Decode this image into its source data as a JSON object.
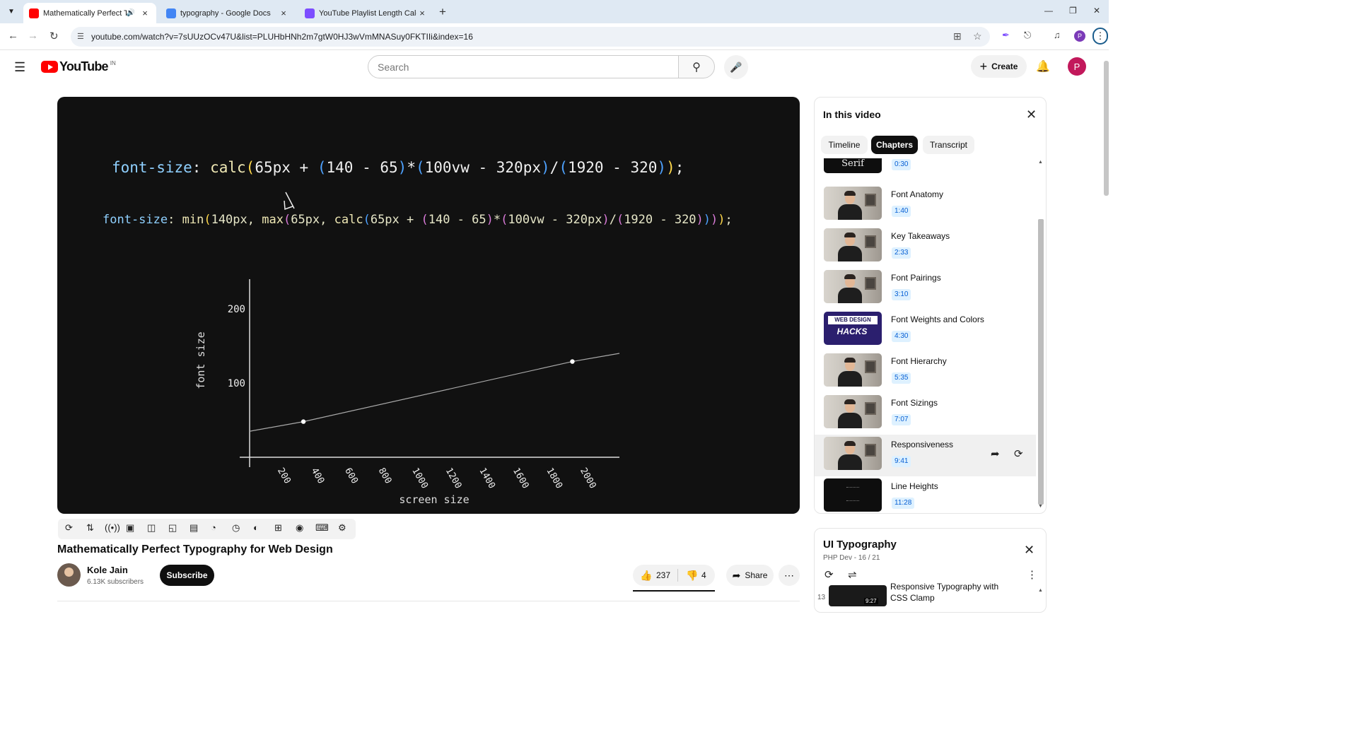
{
  "browser": {
    "tabs": [
      {
        "title": "Mathematically Perfect Typo",
        "active": true
      },
      {
        "title": "typography - Google Docs",
        "active": false
      },
      {
        "title": "YouTube Playlist Length Calcula",
        "active": false
      }
    ],
    "url": "youtube.com/watch?v=7sUUzOCv47U&list=PLUHbHNh2m7gtW0HJ3wVmMNASuy0FKTIIi&index=16"
  },
  "header": {
    "logo_text": "YouTube",
    "country_code": "IN",
    "search_placeholder": "Search",
    "create_label": "Create",
    "avatar_letter": "P"
  },
  "video": {
    "code_line1": [
      {
        "t": "font-size",
        "c": "kw"
      },
      {
        "t": ": ",
        "c": "txt"
      },
      {
        "t": "calc",
        "c": "fn"
      },
      {
        "t": "(",
        "c": "p1"
      },
      {
        "t": "65px + ",
        "c": "txt"
      },
      {
        "t": "(",
        "c": "p3"
      },
      {
        "t": "140 - 65",
        "c": "txt"
      },
      {
        "t": ")",
        "c": "p3"
      },
      {
        "t": "*",
        "c": "txt"
      },
      {
        "t": "(",
        "c": "p3"
      },
      {
        "t": "100vw - 320px",
        "c": "txt"
      },
      {
        "t": ")",
        "c": "p3"
      },
      {
        "t": "/",
        "c": "txt"
      },
      {
        "t": "(",
        "c": "p3"
      },
      {
        "t": "1920 - 320",
        "c": "txt"
      },
      {
        "t": ")",
        "c": "p3"
      },
      {
        "t": ")",
        "c": "p1"
      },
      {
        "t": ";",
        "c": "txt"
      }
    ],
    "code_line2": [
      {
        "t": "font-size",
        "c": "kw"
      },
      {
        "t": ": ",
        "c": "txt"
      },
      {
        "t": "min",
        "c": "fn"
      },
      {
        "t": "(",
        "c": "p1"
      },
      {
        "t": "140px, ",
        "c": "txt"
      },
      {
        "t": "max",
        "c": "fn"
      },
      {
        "t": "(",
        "c": "p2"
      },
      {
        "t": "65px, ",
        "c": "txt"
      },
      {
        "t": "calc",
        "c": "fn"
      },
      {
        "t": "(",
        "c": "p3"
      },
      {
        "t": "65px + ",
        "c": "txt"
      },
      {
        "t": "(",
        "c": "p2"
      },
      {
        "t": "140 - 65",
        "c": "txt"
      },
      {
        "t": ")",
        "c": "p2"
      },
      {
        "t": "*",
        "c": "txt"
      },
      {
        "t": "(",
        "c": "p2"
      },
      {
        "t": "100vw - 320px",
        "c": "txt"
      },
      {
        "t": ")",
        "c": "p2"
      },
      {
        "t": "/",
        "c": "txt"
      },
      {
        "t": "(",
        "c": "p2"
      },
      {
        "t": "1920 - 320",
        "c": "txt"
      },
      {
        "t": ")",
        "c": "p2"
      },
      {
        "t": ")",
        "c": "p3"
      },
      {
        "t": ")",
        "c": "p2"
      },
      {
        "t": ")",
        "c": "p1"
      },
      {
        "t": ";",
        "c": "txt"
      }
    ],
    "title": "Mathematically Perfect Typography for Web Design",
    "channel": "Kole Jain",
    "subscribers": "6.13K subscribers",
    "subscribe_label": "Subscribe",
    "likes": "237",
    "dislikes": "4",
    "share_label": "Share"
  },
  "chart_data": {
    "type": "line",
    "xlabel": "screen size",
    "ylabel": "font size",
    "x_ticks": [
      200,
      400,
      600,
      800,
      1000,
      1200,
      1400,
      1600,
      1800,
      2000
    ],
    "y_ticks": [
      100,
      200
    ],
    "xlim": [
      0,
      2200
    ],
    "ylim": [
      0,
      240
    ],
    "series": [
      {
        "x": [
          0,
          320,
          1920,
          2200
        ],
        "y": [
          35,
          48,
          129,
          140
        ]
      }
    ],
    "points": [
      {
        "x": 320,
        "y": 48
      },
      {
        "x": 1920,
        "y": 129
      }
    ]
  },
  "chapters_panel": {
    "title": "In this video",
    "tabs": [
      "Timeline",
      "Chapters",
      "Transcript"
    ],
    "selected_tab": "Chapters",
    "partial_top": {
      "thumb_text": "Serif",
      "time": "0:30"
    },
    "items": [
      {
        "name": "Font Anatomy",
        "time": "1:40",
        "thumb": "person"
      },
      {
        "name": "Key Takeaways",
        "time": "2:33",
        "thumb": "person"
      },
      {
        "name": "Font Pairings",
        "time": "3:10",
        "thumb": "person"
      },
      {
        "name": "Font Weights and Colors",
        "time": "4:30",
        "thumb": "webdesign"
      },
      {
        "name": "Font Hierarchy",
        "time": "5:35",
        "thumb": "person"
      },
      {
        "name": "Font Sizings",
        "time": "7:07",
        "thumb": "person"
      },
      {
        "name": "Responsiveness",
        "time": "9:41",
        "thumb": "person",
        "highlighted": true
      },
      {
        "name": "Line Heights",
        "time": "11:28",
        "thumb": "dark"
      }
    ],
    "web_design_thumb": {
      "line1": "WEB DESIGN",
      "line2": "HACKS"
    }
  },
  "playlist": {
    "title": "UI Typography",
    "subtitle": "PHP Dev - 16 / 21",
    "item_number": "13",
    "item_title_line1": "Responsive Typography with",
    "item_title_line2": "CSS Clamp",
    "item_duration": "9:27"
  }
}
